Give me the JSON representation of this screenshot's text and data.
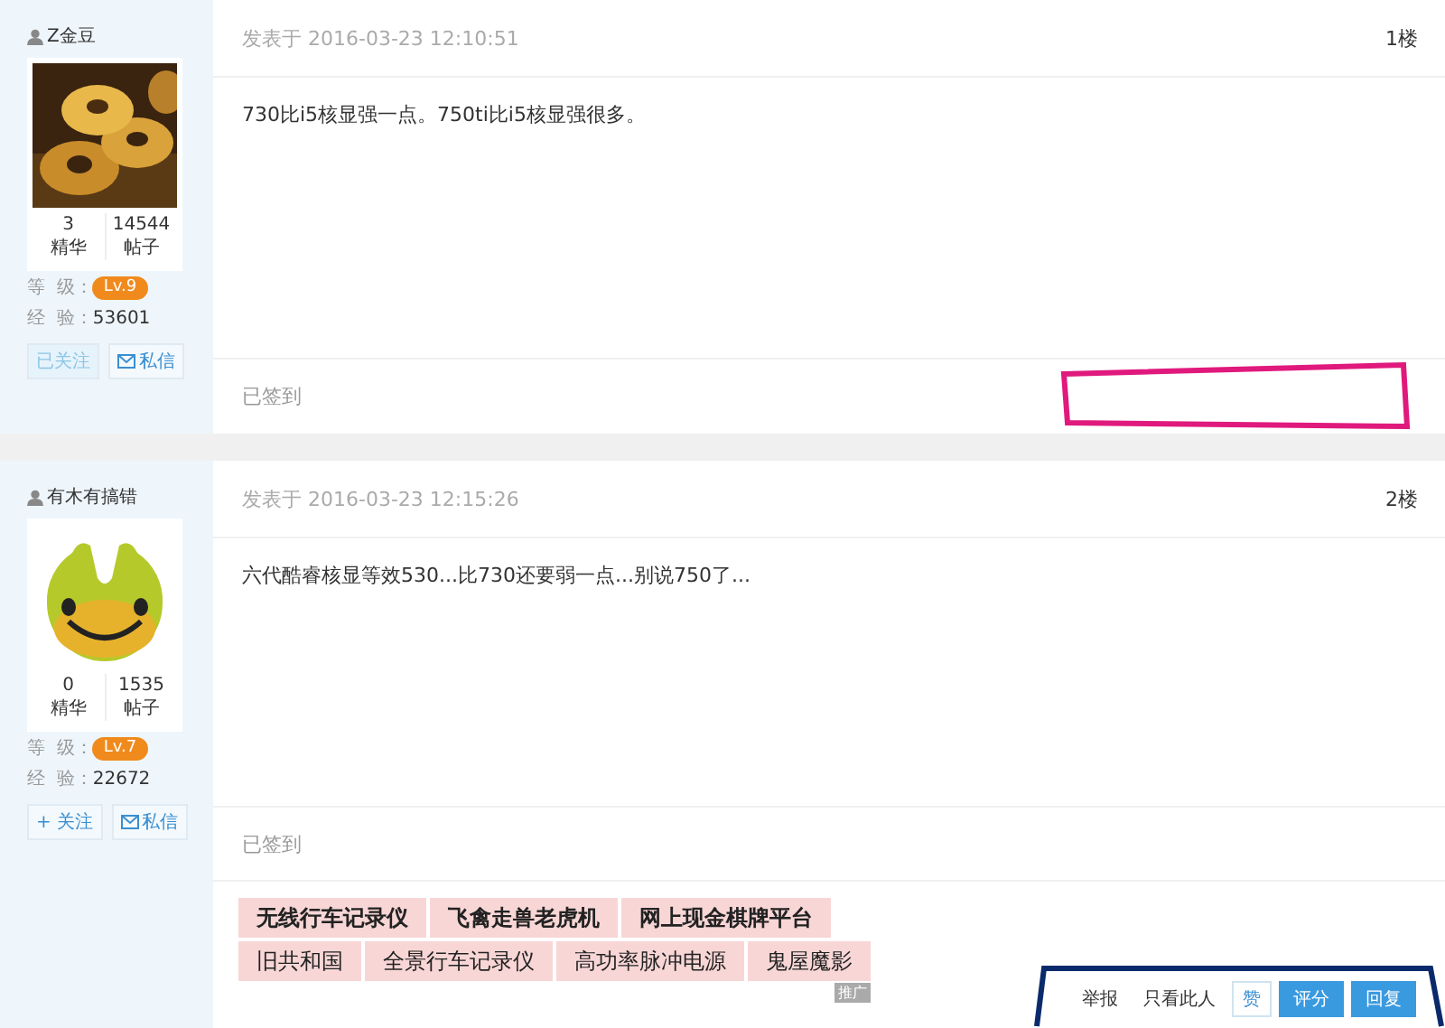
{
  "posts": [
    {
      "author": "Z金豆",
      "avatar": {
        "kind": "picture"
      },
      "stats": [
        {
          "value": "3",
          "label": "精华"
        },
        {
          "value": "14544",
          "label": "帖子"
        }
      ],
      "level_label": "等  级：",
      "level": "Lv.9",
      "exp_label": "经  验：",
      "exp": "53601",
      "follow": {
        "label": "已关注",
        "selected": true
      },
      "message": "私信",
      "posted": "发表于 2016-03-23 12:10:51",
      "floor": "1楼",
      "body": "730比i5核显强一点。750ti比i5核显强很多。",
      "signature": "已签到"
    },
    {
      "author": "有木有搞错",
      "avatar": {
        "kind": "picture"
      },
      "stats": [
        {
          "value": "0",
          "label": "精华"
        },
        {
          "value": "1535",
          "label": "帖子"
        }
      ],
      "level_label": "等  级：",
      "level": "Lv.7",
      "exp_label": "经  验：",
      "exp": "22672",
      "follow": {
        "label": "+ 关注",
        "selected": false
      },
      "message": "私信",
      "posted": "发表于 2016-03-23 12:15:26",
      "floor": "2楼",
      "body": "六代酷睿核显等效530...比730还要弱一点...别说750了...",
      "signature": "已签到",
      "ads": [
        [
          {
            "text": "无线行车记录仪",
            "bold": true
          },
          {
            "text": "飞禽走兽老虎机",
            "bold": true
          },
          {
            "text": "网上现金棋牌平台",
            "bold": true
          }
        ],
        [
          {
            "text": "旧共和国",
            "bold": false
          },
          {
            "text": "全景行车记录仪",
            "bold": false
          },
          {
            "text": "高功率脉冲电源",
            "bold": false
          },
          {
            "text": "鬼屋魔影",
            "bold": false
          }
        ]
      ],
      "ad_tag": "推广",
      "actions": [
        {
          "label": "举报",
          "kind": "link"
        },
        {
          "label": "只看此人",
          "kind": "link"
        },
        {
          "label": "赞",
          "kind": "outline"
        },
        {
          "label": "评分",
          "kind": "primary"
        },
        {
          "label": "回复",
          "kind": "primary"
        }
      ]
    }
  ],
  "annotations": [
    {
      "color": "#e0197d"
    },
    {
      "color": "#0a2a6b"
    }
  ]
}
